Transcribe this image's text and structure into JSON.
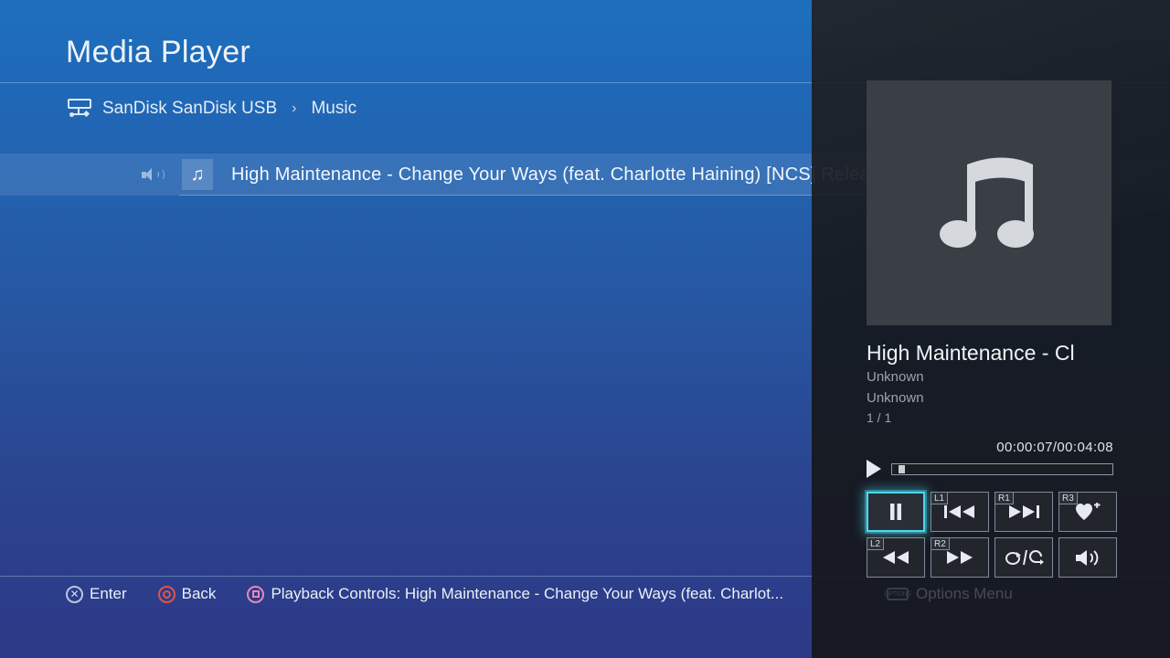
{
  "header": {
    "title": "Media Player"
  },
  "breadcrumb": {
    "device_icon": "usb-drive-icon",
    "device": "SanDisk SanDisk USB",
    "separator": "›",
    "folder": "Music"
  },
  "list": {
    "rows": [
      {
        "playing_icon": "speaker-icon",
        "file_icon": "music-note-icon",
        "title": "High Maintenance - Change Your Ways (feat. Charlotte Haining) [NCS] Relea...",
        "selected": true
      }
    ]
  },
  "now_playing": {
    "art_icon": "music-note-icon",
    "title": "High Maintenance - Cl",
    "artist": "Unknown",
    "album": "Unknown",
    "index": "1 / 1",
    "time": "00:00:07/00:04:08",
    "play_state_icon": "play-icon",
    "progress_percent": 2.8,
    "controls": [
      {
        "name": "pause-button",
        "tag": "",
        "icon": "pause-icon",
        "active": true
      },
      {
        "name": "previous-button",
        "tag": "L1",
        "icon": "skip-back-icon",
        "active": false
      },
      {
        "name": "next-button",
        "tag": "R1",
        "icon": "skip-forward-icon",
        "active": false
      },
      {
        "name": "add-favorite-button",
        "tag": "R3",
        "icon": "heart-plus-icon",
        "active": false
      },
      {
        "name": "rewind-button",
        "tag": "L2",
        "icon": "rewind-icon",
        "active": false
      },
      {
        "name": "fast-forward-button",
        "tag": "R2",
        "icon": "fast-forward-icon",
        "active": false
      },
      {
        "name": "repeat-button",
        "tag": "",
        "icon": "repeat-icon",
        "active": false
      },
      {
        "name": "volume-button",
        "tag": "",
        "icon": "volume-icon",
        "active": false
      }
    ]
  },
  "footer": {
    "enter": "Enter",
    "back": "Back",
    "playback": "Playback Controls: High Maintenance - Change Your Ways (feat. Charlot...",
    "options": "Options Menu",
    "options_tag": "OPTIONS"
  },
  "colors": {
    "accent_cyan": "#4ad9ee",
    "bg_top": "#1d6fbd",
    "bg_bottom": "#2d3a88",
    "panel": "#16181c",
    "album_art": "#3a3f46"
  }
}
